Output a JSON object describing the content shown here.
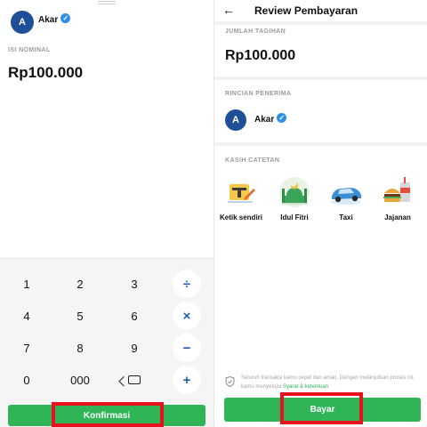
{
  "left": {
    "recipient": {
      "initial": "A",
      "name": "Akar"
    },
    "section_label": "ISI NOMINAL",
    "amount": "Rp100.000",
    "keypad": {
      "keys": [
        "1",
        "2",
        "3",
        "4",
        "5",
        "6",
        "7",
        "8",
        "9",
        "0",
        "000"
      ],
      "ops": {
        "divide": "÷",
        "multiply": "×",
        "minus": "−",
        "plus": "+"
      }
    },
    "confirm_label": "Konfirmasi"
  },
  "right": {
    "back_glyph": "←",
    "title": "Review Pembayaran",
    "jumlah_label": "JUMLAH TAGIHAN",
    "amount": "Rp100.000",
    "rincian_label": "RINCIAN PENERIMA",
    "recipient": {
      "initial": "A",
      "name": "Akar"
    },
    "kasih_label": "KASIH CATETAN",
    "notes": [
      {
        "label": "Ketik sendiri",
        "icon": "pencil-note-icon"
      },
      {
        "label": "Idul Fitri",
        "icon": "mosque-icon"
      },
      {
        "label": "Taxi",
        "icon": "car-icon"
      },
      {
        "label": "Jajanan",
        "icon": "burger-drink-icon"
      }
    ],
    "terms_text": "Seluruh transaksi kamu cepat dan aman. Dengan melanjutkan proses ini, kamu menyetujui",
    "terms_link": "Syarat & ketentuan",
    "pay_label": "Bayar"
  },
  "colors": {
    "accent_green": "#2fb456",
    "avatar_blue": "#1f4f96",
    "highlight_red": "#e8121e",
    "op_blue": "#1f5fae"
  }
}
